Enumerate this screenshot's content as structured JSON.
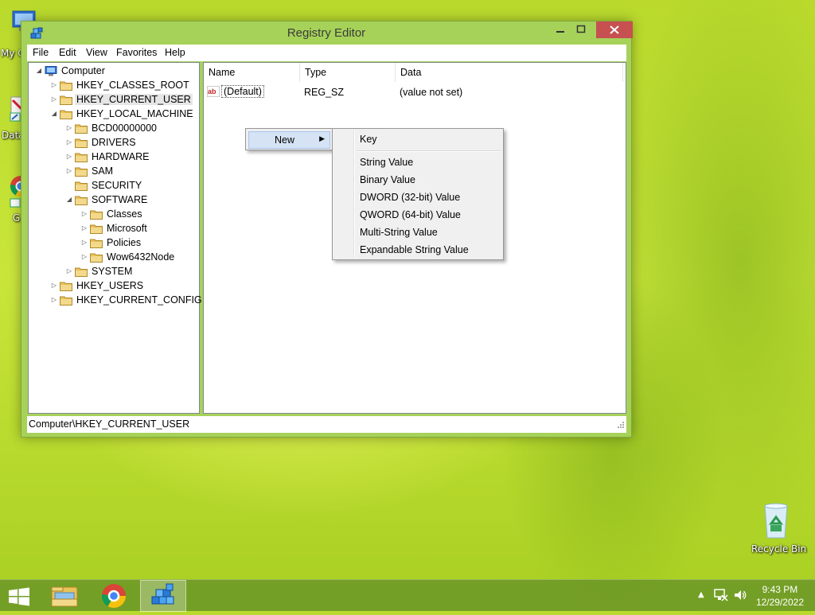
{
  "desktop": {
    "icons": [
      {
        "label": "My C",
        "name": "desktop-icon-my-computer"
      },
      {
        "label": "Data",
        "name": "desktop-icon-data"
      },
      {
        "label": "G",
        "name": "desktop-icon-google-chrome"
      },
      {
        "label": "Recycle Bin",
        "name": "desktop-icon-recycle-bin"
      }
    ]
  },
  "window": {
    "title": "Registry Editor",
    "controls": {
      "minimize": "—",
      "maximize": "□",
      "close": "✕"
    },
    "menu": [
      "File",
      "Edit",
      "View",
      "Favorites",
      "Help"
    ],
    "tree": [
      {
        "label": "Computer",
        "level": 0,
        "expanded": true,
        "kind": "computer"
      },
      {
        "label": "HKEY_CLASSES_ROOT",
        "level": 1,
        "expanded": false
      },
      {
        "label": "HKEY_CURRENT_USER",
        "level": 1,
        "expanded": false,
        "selected": true
      },
      {
        "label": "HKEY_LOCAL_MACHINE",
        "level": 1,
        "expanded": true
      },
      {
        "label": "BCD00000000",
        "level": 2,
        "expanded": false
      },
      {
        "label": "DRIVERS",
        "level": 2,
        "expanded": false
      },
      {
        "label": "HARDWARE",
        "level": 2,
        "expanded": false
      },
      {
        "label": "SAM",
        "level": 2,
        "expanded": false
      },
      {
        "label": "SECURITY",
        "level": 2,
        "leaf": true
      },
      {
        "label": "SOFTWARE",
        "level": 2,
        "expanded": true
      },
      {
        "label": "Classes",
        "level": 3,
        "expanded": false
      },
      {
        "label": "Microsoft",
        "level": 3,
        "expanded": false
      },
      {
        "label": "Policies",
        "level": 3,
        "expanded": false
      },
      {
        "label": "Wow6432Node",
        "level": 3,
        "expanded": false
      },
      {
        "label": "SYSTEM",
        "level": 2,
        "expanded": false
      },
      {
        "label": "HKEY_USERS",
        "level": 1,
        "expanded": false
      },
      {
        "label": "HKEY_CURRENT_CONFIG",
        "level": 1,
        "expanded": false
      }
    ],
    "columns": [
      "Name",
      "Type",
      "Data"
    ],
    "values": [
      {
        "name": "(Default)",
        "type": "REG_SZ",
        "data": "(value not set)"
      }
    ],
    "status": "Computer\\HKEY_CURRENT_USER"
  },
  "context_menu": {
    "new_label": "New",
    "submenu_arrow": "▶",
    "submenu": {
      "first": "Key",
      "items": [
        "String Value",
        "Binary Value",
        "DWORD (32-bit) Value",
        "QWORD (64-bit) Value",
        "Multi-String Value",
        "Expandable String Value"
      ]
    }
  },
  "taskbar": {
    "apps": [
      "file-explorer",
      "google-chrome",
      "registry-editor"
    ],
    "active_app": "registry-editor",
    "tray": {
      "show_hidden": "▲"
    },
    "clock": {
      "time": "9:43 PM",
      "date": "12/29/2022"
    }
  },
  "colors": {
    "window_frame": "#a6d25a",
    "close_button": "#c75050",
    "menu_highlight": "#d5e3f5",
    "folder": "#e8c25a"
  }
}
